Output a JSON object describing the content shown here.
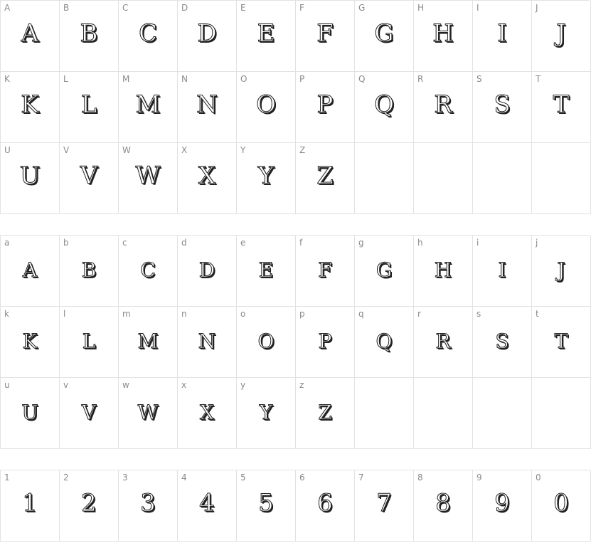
{
  "uppercase": {
    "cells": [
      {
        "label": "A",
        "glyph": "A"
      },
      {
        "label": "B",
        "glyph": "B"
      },
      {
        "label": "C",
        "glyph": "C"
      },
      {
        "label": "D",
        "glyph": "D"
      },
      {
        "label": "E",
        "glyph": "E"
      },
      {
        "label": "F",
        "glyph": "F"
      },
      {
        "label": "G",
        "glyph": "G"
      },
      {
        "label": "H",
        "glyph": "H"
      },
      {
        "label": "I",
        "glyph": "I"
      },
      {
        "label": "J",
        "glyph": "J"
      },
      {
        "label": "K",
        "glyph": "K"
      },
      {
        "label": "L",
        "glyph": "L"
      },
      {
        "label": "M",
        "glyph": "M"
      },
      {
        "label": "N",
        "glyph": "N"
      },
      {
        "label": "O",
        "glyph": "O"
      },
      {
        "label": "P",
        "glyph": "P"
      },
      {
        "label": "Q",
        "glyph": "Q"
      },
      {
        "label": "R",
        "glyph": "R"
      },
      {
        "label": "S",
        "glyph": "S"
      },
      {
        "label": "T",
        "glyph": "T"
      },
      {
        "label": "U",
        "glyph": "U"
      },
      {
        "label": "V",
        "glyph": "V"
      },
      {
        "label": "W",
        "glyph": "W"
      },
      {
        "label": "X",
        "glyph": "X"
      },
      {
        "label": "Y",
        "glyph": "Y"
      },
      {
        "label": "Z",
        "glyph": "Z"
      },
      {
        "label": "",
        "glyph": ""
      },
      {
        "label": "",
        "glyph": ""
      },
      {
        "label": "",
        "glyph": ""
      },
      {
        "label": "",
        "glyph": ""
      }
    ]
  },
  "lowercase": {
    "cells": [
      {
        "label": "a",
        "glyph": "A"
      },
      {
        "label": "b",
        "glyph": "B"
      },
      {
        "label": "c",
        "glyph": "C"
      },
      {
        "label": "d",
        "glyph": "D"
      },
      {
        "label": "e",
        "glyph": "E"
      },
      {
        "label": "f",
        "glyph": "F"
      },
      {
        "label": "g",
        "glyph": "G"
      },
      {
        "label": "h",
        "glyph": "H"
      },
      {
        "label": "i",
        "glyph": "I"
      },
      {
        "label": "j",
        "glyph": "J"
      },
      {
        "label": "k",
        "glyph": "K"
      },
      {
        "label": "l",
        "glyph": "L"
      },
      {
        "label": "m",
        "glyph": "M"
      },
      {
        "label": "n",
        "glyph": "N"
      },
      {
        "label": "o",
        "glyph": "O"
      },
      {
        "label": "p",
        "glyph": "P"
      },
      {
        "label": "q",
        "glyph": "Q"
      },
      {
        "label": "r",
        "glyph": "R"
      },
      {
        "label": "s",
        "glyph": "S"
      },
      {
        "label": "t",
        "glyph": "T"
      },
      {
        "label": "u",
        "glyph": "U"
      },
      {
        "label": "v",
        "glyph": "V"
      },
      {
        "label": "w",
        "glyph": "W"
      },
      {
        "label": "x",
        "glyph": "X"
      },
      {
        "label": "y",
        "glyph": "Y"
      },
      {
        "label": "z",
        "glyph": "Z"
      },
      {
        "label": "",
        "glyph": ""
      },
      {
        "label": "",
        "glyph": ""
      },
      {
        "label": "",
        "glyph": ""
      },
      {
        "label": "",
        "glyph": ""
      }
    ]
  },
  "digits": {
    "cells": [
      {
        "label": "1",
        "glyph": "1"
      },
      {
        "label": "2",
        "glyph": "2"
      },
      {
        "label": "3",
        "glyph": "3"
      },
      {
        "label": "4",
        "glyph": "4"
      },
      {
        "label": "5",
        "glyph": "5"
      },
      {
        "label": "6",
        "glyph": "6"
      },
      {
        "label": "7",
        "glyph": "7"
      },
      {
        "label": "8",
        "glyph": "8"
      },
      {
        "label": "9",
        "glyph": "9"
      },
      {
        "label": "0",
        "glyph": "0"
      }
    ]
  }
}
